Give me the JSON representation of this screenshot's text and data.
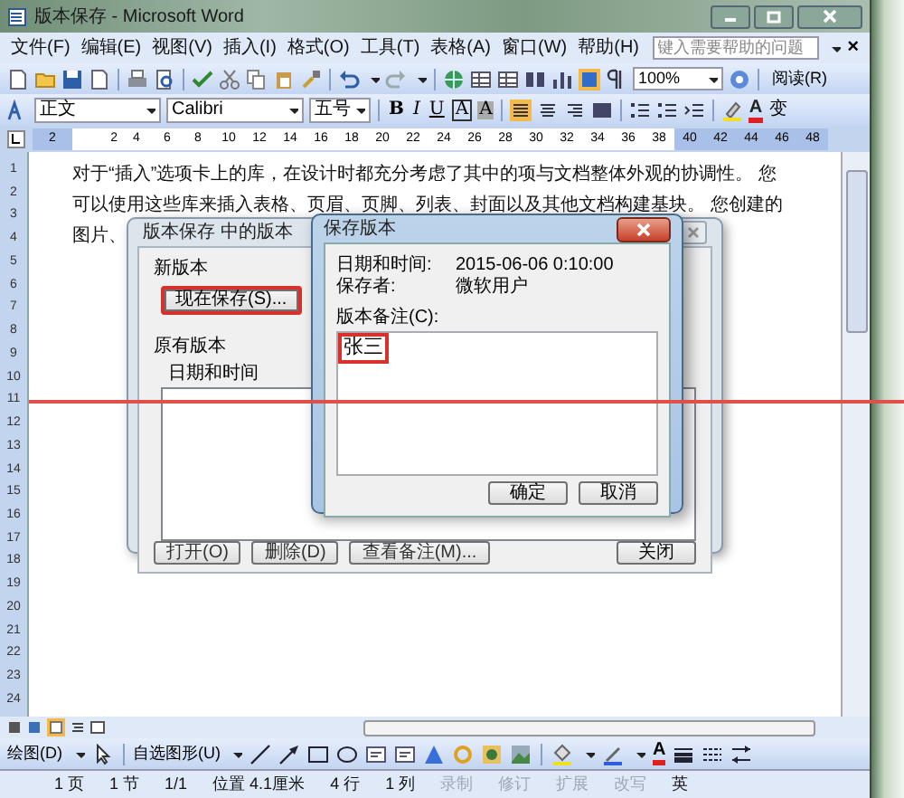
{
  "window": {
    "title": "版本保存 - Microsoft Word",
    "help_placeholder": "键入需要帮助的问题",
    "close_doc": "×"
  },
  "menu": [
    "文件(F)",
    "编辑(E)",
    "视图(V)",
    "插入(I)",
    "格式(O)",
    "工具(T)",
    "表格(A)",
    "窗口(W)",
    "帮助(H)"
  ],
  "standard_toolbar": {
    "zoom": "100%",
    "read_button": "阅读(R)"
  },
  "formatting_toolbar": {
    "style": "正文",
    "font": "Calibri",
    "size": "五号",
    "bold": "B",
    "italic": "I",
    "underline": "U",
    "char_border": "A",
    "char_shading": "A",
    "font_color": "A",
    "phonetic": "变"
  },
  "ruler": [
    {
      "label": "2",
      "margin": true
    },
    {
      "label": "2",
      "margin": false
    },
    {
      "label": "4",
      "margin": false
    },
    {
      "label": "6",
      "margin": false
    },
    {
      "label": "8",
      "margin": false
    },
    {
      "label": "10",
      "margin": false
    },
    {
      "label": "12",
      "margin": false
    },
    {
      "label": "14",
      "margin": false
    },
    {
      "label": "16",
      "margin": false
    },
    {
      "label": "18",
      "margin": false
    },
    {
      "label": "20",
      "margin": false
    },
    {
      "label": "22",
      "margin": false
    },
    {
      "label": "24",
      "margin": false
    },
    {
      "label": "26",
      "margin": false
    },
    {
      "label": "28",
      "margin": false
    },
    {
      "label": "30",
      "margin": false
    },
    {
      "label": "32",
      "margin": false
    },
    {
      "label": "34",
      "margin": false
    },
    {
      "label": "36",
      "margin": false
    },
    {
      "label": "38",
      "margin": false
    },
    {
      "label": "40",
      "margin": true
    },
    {
      "label": "42",
      "margin": true
    },
    {
      "label": "44",
      "margin": true
    },
    {
      "label": "46",
      "margin": true
    },
    {
      "label": "48",
      "margin": true
    }
  ],
  "vertical_ruler": [
    "1",
    "2",
    "3",
    "4",
    "5",
    "6",
    "7",
    "8",
    "9",
    "10",
    "11",
    "12",
    "13",
    "14",
    "15",
    "16",
    "17",
    "18",
    "19",
    "20",
    "21",
    "22",
    "23",
    "24"
  ],
  "document": {
    "lines": [
      "对于“插入”选项卡上的库，在设计时都充分考虑了其中的项与文档整体外观的协调性。 您",
      "可以使用这些库来插入表格、页眉、页脚、列表、封面以及其他文档构建基块。 您创建的",
      "图片、"
    ]
  },
  "versions_dialog": {
    "title": "版本保存 中的版本",
    "new_version_label": "新版本",
    "save_now_button": {
      "label": "现在保存(S)...",
      "highlighted": true
    },
    "existing_label": "原有版本",
    "columns": [
      "日期和时间"
    ],
    "buttons": [
      "打开(O)",
      "删除(D)",
      "查看备注(M)..."
    ],
    "close_button": "关闭"
  },
  "save_dialog": {
    "title": "保存版本",
    "fields": [
      {
        "label": "日期和时间:",
        "value": "2015-06-06 0:10:00"
      },
      {
        "label": "保存者:",
        "value": "微软用户"
      }
    ],
    "note_label": "版本备注(C):",
    "note": {
      "value": "张三",
      "highlighted": true
    },
    "buttons": [
      "确定",
      "取消"
    ]
  },
  "drawing_toolbar": {
    "draw_menu": "绘图(D)",
    "autoshapes_menu": "自选图形(U)",
    "font_color": "A"
  },
  "status_bar": [
    {
      "label": "1 页",
      "disabled": false
    },
    {
      "label": "1 节",
      "disabled": false
    },
    {
      "label": "1/1",
      "disabled": false
    },
    {
      "label": "位置 4.1厘米",
      "disabled": false
    },
    {
      "label": "4 行",
      "disabled": false
    },
    {
      "label": "1 列",
      "disabled": false
    },
    {
      "label": "录制",
      "disabled": true
    },
    {
      "label": "修订",
      "disabled": true
    },
    {
      "label": "扩展",
      "disabled": true
    },
    {
      "label": "改写",
      "disabled": true
    },
    {
      "label": "英",
      "disabled": false
    }
  ],
  "annotation_line": true
}
